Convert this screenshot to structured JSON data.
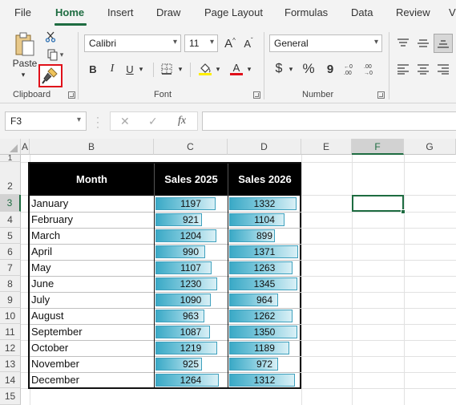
{
  "tabs": [
    "File",
    "Home",
    "Insert",
    "Draw",
    "Page Layout",
    "Formulas",
    "Data",
    "Review",
    "V"
  ],
  "ribbon": {
    "clipboard": {
      "paste_label": "Paste",
      "group_label": "Clipboard"
    },
    "font": {
      "font_name": "Calibri",
      "font_size": "11",
      "group_label": "Font",
      "grow": "A",
      "shrink": "A",
      "bold": "B",
      "italic": "I",
      "underline": "U",
      "fill_color": "#ffee00",
      "font_color": "#e0101a"
    },
    "number": {
      "format": "General",
      "group_label": "Number",
      "currency": "$",
      "percent": "%",
      "comma": "9"
    },
    "accent": "#1e6c41"
  },
  "formula_bar": {
    "name_box": "F3",
    "fx": "fx",
    "formula": ""
  },
  "columns": [
    "A",
    "B",
    "C",
    "D",
    "E",
    "F",
    "G"
  ],
  "rows": [
    "1",
    "2",
    "3",
    "4",
    "5",
    "6",
    "7",
    "8",
    "9",
    "10",
    "11",
    "12",
    "13",
    "14",
    "15"
  ],
  "table": {
    "headers": [
      "Month",
      "Sales 2025",
      "Sales 2026"
    ],
    "rows": [
      {
        "month": "January",
        "s2025": "1197",
        "s2026": "1332"
      },
      {
        "month": "February",
        "s2025": "921",
        "s2026": "1104"
      },
      {
        "month": "March",
        "s2025": "1204",
        "s2026": "899"
      },
      {
        "month": "April",
        "s2025": "990",
        "s2026": "1371"
      },
      {
        "month": "May",
        "s2025": "1107",
        "s2026": "1263"
      },
      {
        "month": "June",
        "s2025": "1230",
        "s2026": "1345"
      },
      {
        "month": "July",
        "s2025": "1090",
        "s2026": "964"
      },
      {
        "month": "August",
        "s2025": "963",
        "s2026": "1262"
      },
      {
        "month": "September",
        "s2025": "1087",
        "s2026": "1350"
      },
      {
        "month": "October",
        "s2025": "1219",
        "s2026": "1189"
      },
      {
        "month": "November",
        "s2025": "925",
        "s2026": "972"
      },
      {
        "month": "December",
        "s2025": "1264",
        "s2026": "1312"
      }
    ]
  },
  "data_bar_color": "#3aa9c6"
}
